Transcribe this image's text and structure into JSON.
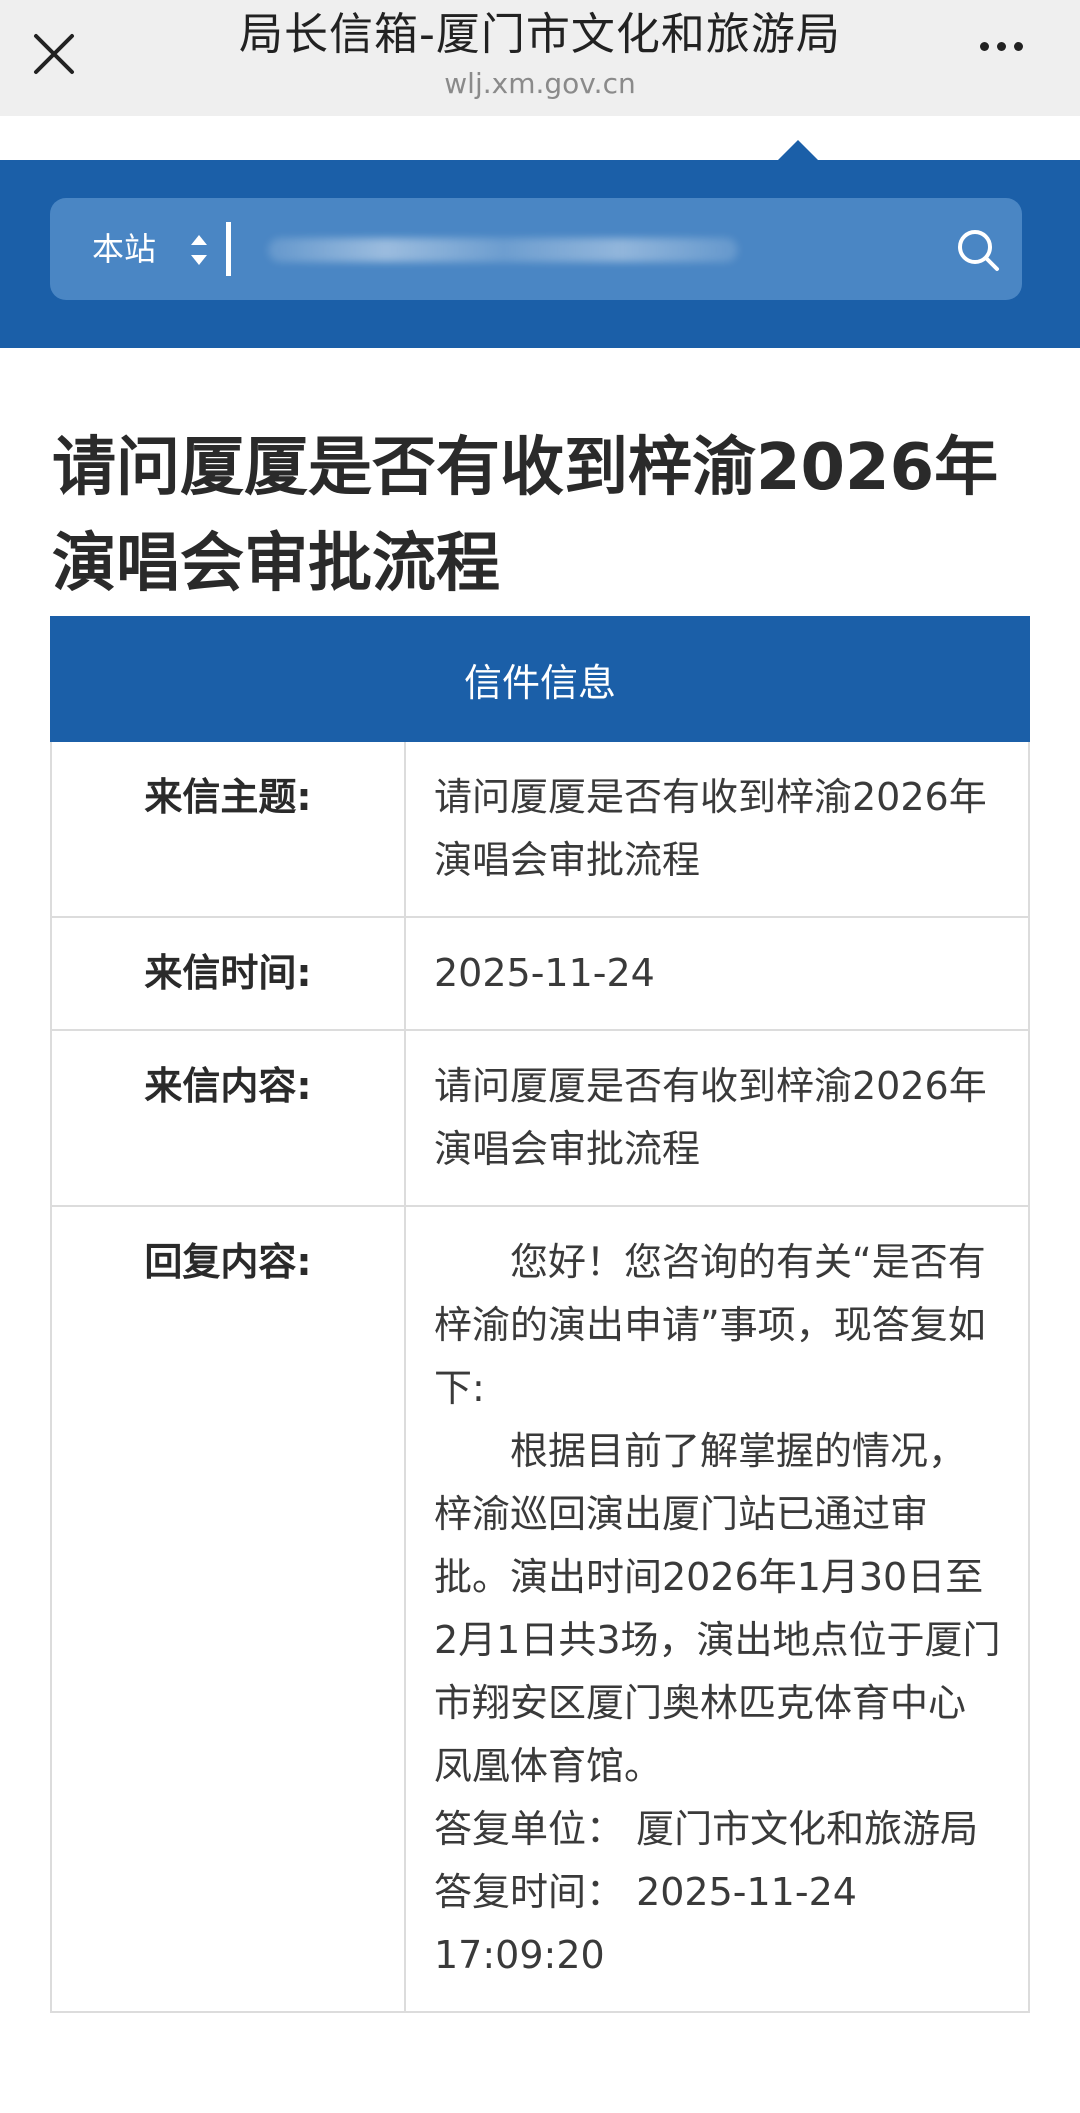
{
  "browser": {
    "title": "局长信箱-厦门市文化和旅游局",
    "url": "wlj.xm.gov.cn"
  },
  "search": {
    "scope": "本站"
  },
  "heading": "请问厦厦是否有收到梓渝2026年演唱会审批流程",
  "table": {
    "header": "信件信息",
    "rows": [
      {
        "label": "来信主题:",
        "value": "请问厦厦是否有收到梓渝2026年演唱会审批流程"
      },
      {
        "label": "来信时间:",
        "value": "2025-11-24"
      },
      {
        "label": "来信内容:",
        "value": "请问厦厦是否有收到梓渝2026年演唱会审批流程"
      }
    ],
    "reply": {
      "label": "回复内容:",
      "paragraph1": "您好！您咨询的有关“是否有梓渝的演出申请”事项，现答复如下:",
      "paragraph2": "根据目前了解掌握的情况，梓渝巡回演出厦门站已通过审批。演出时间2026年1月30日至2月1日共3场，演出地点位于厦门市翔安区厦门奥林匹克体育中心凤凰体育馆。",
      "paragraph3": "答复单位： 厦门市文化和旅游局　 答复时间： 2025-11-24 17:09:20"
    }
  },
  "colors": {
    "brand_blue": "#1b5fa8",
    "search_bg": "#4a86c4",
    "topbar_bg": "#efefef"
  }
}
